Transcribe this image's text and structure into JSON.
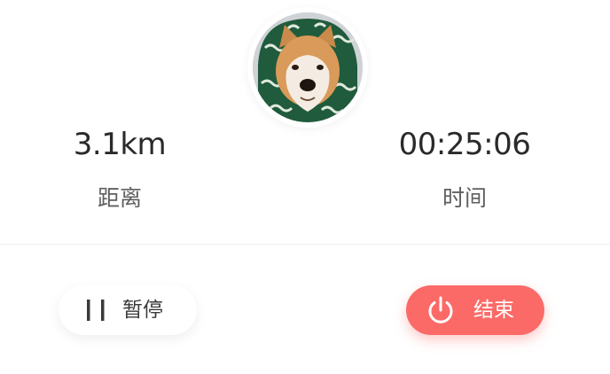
{
  "stats": {
    "distance": {
      "value": "3.1km",
      "label": "距离"
    },
    "time": {
      "value": "00:25:06",
      "label": "时间"
    }
  },
  "avatar": {
    "icon": "shiba-dog-avatar"
  },
  "actions": {
    "pause_label": "暂停",
    "pause_icon": "pause-icon",
    "end_label": "结束",
    "end_icon": "power-icon"
  },
  "colors": {
    "end_button": "#fb6a67",
    "text_primary": "#2a2a2a",
    "text_secondary": "#5f5f5f"
  }
}
